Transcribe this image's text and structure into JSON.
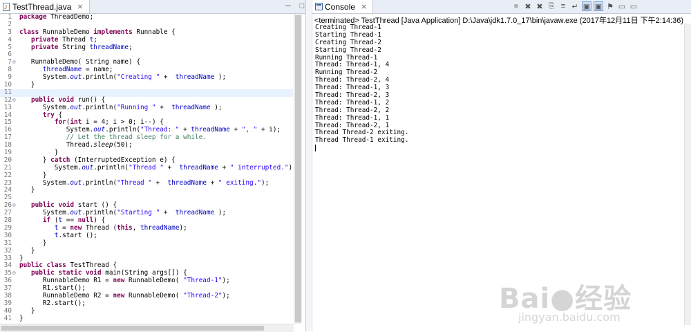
{
  "editor": {
    "tab_label": "TestThread.java",
    "close_glyph": "⨯",
    "lines": [
      {
        "n": "1",
        "html": "<span class=\"kw\">package</span> ThreadDemo;"
      },
      {
        "n": "2",
        "html": ""
      },
      {
        "n": "3",
        "html": "<span class=\"kw\">class</span> RunnableDemo <span class=\"kw\">implements</span> Runnable {"
      },
      {
        "n": "4",
        "html": "   <span class=\"kw\">private</span> Thread <span class=\"fld\">t</span>;"
      },
      {
        "n": "5",
        "html": "   <span class=\"kw\">private</span> String <span class=\"fld\">threadName</span>;"
      },
      {
        "n": "6",
        "html": ""
      },
      {
        "n": "7",
        "fold": true,
        "html": "   RunnableDemo( String name) {"
      },
      {
        "n": "8",
        "html": "      <span class=\"fld\">threadName</span> = name;"
      },
      {
        "n": "9",
        "html": "      System.<span class=\"fld it\">out</span>.println(<span class=\"str\">\"Creating \"</span> +  <span class=\"fld\">threadName</span> );"
      },
      {
        "n": "10",
        "html": "   }"
      },
      {
        "n": "11",
        "hl": true,
        "html": ""
      },
      {
        "n": "12",
        "fold": true,
        "html": "   <span class=\"kw\">public</span> <span class=\"kw\">void</span> run() {"
      },
      {
        "n": "13",
        "html": "      System.<span class=\"fld it\">out</span>.println(<span class=\"str\">\"Running \"</span> +  <span class=\"fld\">threadName</span> );"
      },
      {
        "n": "14",
        "html": "      <span class=\"kw\">try</span> {"
      },
      {
        "n": "15",
        "html": "         <span class=\"kw\">for</span>(<span class=\"kw\">int</span> i = 4; i &gt; 0; i--) {"
      },
      {
        "n": "16",
        "html": "            System.<span class=\"fld it\">out</span>.println(<span class=\"str\">\"Thread: \"</span> + <span class=\"fld\">threadName</span> + <span class=\"str\">\", \"</span> + i);"
      },
      {
        "n": "17",
        "html": "            <span class=\"cmt\">// Let the thread sleep for a while.</span>"
      },
      {
        "n": "18",
        "html": "            Thread.<span class=\"it\">sleep</span>(50);"
      },
      {
        "n": "19",
        "html": "         }"
      },
      {
        "n": "20",
        "html": "      } <span class=\"kw\">catch</span> (InterruptedException e) {"
      },
      {
        "n": "21",
        "html": "         System.<span class=\"fld it\">out</span>.println(<span class=\"str\">\"Thread \"</span> +  <span class=\"fld\">threadName</span> + <span class=\"str\">\" interrupted.\"</span>);"
      },
      {
        "n": "22",
        "html": "      }"
      },
      {
        "n": "23",
        "html": "      System.<span class=\"fld it\">out</span>.println(<span class=\"str\">\"Thread \"</span> +  <span class=\"fld\">threadName</span> + <span class=\"str\">\" exiting.\"</span>);"
      },
      {
        "n": "24",
        "html": "   }"
      },
      {
        "n": "25",
        "html": ""
      },
      {
        "n": "26",
        "fold": true,
        "html": "   <span class=\"kw\">public</span> <span class=\"kw\">void</span> start () {"
      },
      {
        "n": "27",
        "html": "      System.<span class=\"fld it\">out</span>.println(<span class=\"str\">\"Starting \"</span> +  <span class=\"fld\">threadName</span> );"
      },
      {
        "n": "28",
        "html": "      <span class=\"kw\">if</span> (<span class=\"fld\">t</span> == <span class=\"kw\">null</span>) {"
      },
      {
        "n": "29",
        "html": "         <span class=\"fld\">t</span> = <span class=\"kw\">new</span> Thread (<span class=\"kw\">this</span>, <span class=\"fld\">threadName</span>);"
      },
      {
        "n": "30",
        "html": "         <span class=\"fld\">t</span>.start ();"
      },
      {
        "n": "31",
        "html": "      }"
      },
      {
        "n": "32",
        "html": "   }"
      },
      {
        "n": "33",
        "html": "}"
      },
      {
        "n": "34",
        "html": "<span class=\"kw\">public</span> <span class=\"kw\">class</span> TestThread {"
      },
      {
        "n": "35",
        "fold": true,
        "html": "   <span class=\"kw\">public</span> <span class=\"kw\">static</span> <span class=\"kw\">void</span> main(String args[]) {"
      },
      {
        "n": "36",
        "html": "      RunnableDemo R1 = <span class=\"kw\">new</span> RunnableDemo( <span class=\"str\">\"Thread-1\"</span>);"
      },
      {
        "n": "37",
        "html": "      R1.start();"
      },
      {
        "n": "38",
        "html": "      RunnableDemo R2 = <span class=\"kw\">new</span> RunnableDemo( <span class=\"str\">\"Thread-2\"</span>);"
      },
      {
        "n": "39",
        "html": "      R2.start();"
      },
      {
        "n": "40",
        "html": "   }"
      },
      {
        "n": "41",
        "html": "}"
      }
    ]
  },
  "console": {
    "tab_label": "Console",
    "header": "<terminated> TestThread [Java Application] D:\\Java\\jdk1.7.0_17\\bin\\javaw.exe (2017年12月11日 下午2:14:36)",
    "output": [
      "Creating Thread-1",
      "Starting Thread-1",
      "Creating Thread-2",
      "Starting Thread-2",
      "Running Thread-1",
      "Thread: Thread-1, 4",
      "Running Thread-2",
      "Thread: Thread-2, 4",
      "Thread: Thread-1, 3",
      "Thread: Thread-2, 3",
      "Thread: Thread-1, 2",
      "Thread: Thread-2, 2",
      "Thread: Thread-1, 1",
      "Thread: Thread-2, 1",
      "Thread Thread-2 exiting.",
      "Thread Thread-1 exiting."
    ],
    "toolbar_icons": [
      "terminate-icon",
      "remove-launch-icon",
      "remove-all-launches-icon",
      "copy-icon",
      "scroll-lock-icon",
      "word-wrap-icon",
      "show-console-on-output-icon",
      "show-console-on-error-icon",
      "pin-console-icon",
      "display-console-icon",
      "open-console-icon"
    ]
  },
  "watermark": {
    "logo": "Bai●经验",
    "url": "jingyan.baidu.com"
  },
  "colors": {
    "keyword": "#7f0055",
    "field": "#0000c0",
    "string": "#2a00ff",
    "comment": "#3f7f5f",
    "current_line": "#e8f2fe"
  }
}
